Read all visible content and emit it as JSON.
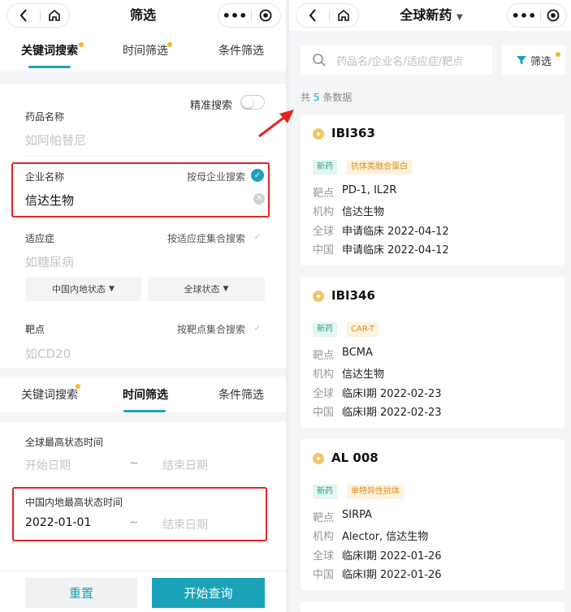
{
  "left": {
    "navbar": {
      "title": "筛选",
      "back_icon": "chevron-left-icon",
      "home_icon": "home-icon",
      "more_icon": "more-dots-icon",
      "record_icon": "target-icon"
    },
    "top_tabs": [
      {
        "label": "关键词搜索",
        "active": true,
        "dot": true
      },
      {
        "label": "时间筛选",
        "active": false,
        "dot": true
      },
      {
        "label": "条件筛选",
        "active": false,
        "dot": false
      }
    ],
    "keyword": {
      "exact_search_label": "精准搜索",
      "drug_name": {
        "label": "药品名称",
        "placeholder": "如阿帕替尼"
      },
      "company": {
        "label": "企业名称",
        "option": "按母企业搜索",
        "option_checked": true,
        "value": "信达生物"
      },
      "indication": {
        "label": "适应症",
        "option": "按适应症集合搜索",
        "option_checked": false,
        "placeholder": "如糖尿病"
      },
      "status_dropdowns": [
        "中国内地状态",
        "全球状态"
      ],
      "target": {
        "label": "靶点",
        "option": "按靶点集合搜索",
        "option_checked": false,
        "placeholder": "如CD20"
      }
    },
    "mid_tabs": [
      {
        "label": "关键词搜索",
        "active": false,
        "dot": true
      },
      {
        "label": "时间筛选",
        "active": true,
        "dot": false
      },
      {
        "label": "条件筛选",
        "active": false,
        "dot": false
      }
    ],
    "time": {
      "global": {
        "label": "全球最高状态时间",
        "start_placeholder": "开始日期",
        "sep": "~",
        "end_placeholder": "结束日期"
      },
      "china": {
        "label": "中国内地最高状态时间",
        "start_value": "2022-01-01",
        "sep": "~",
        "end_placeholder": "结束日期"
      }
    },
    "buttons": {
      "reset": "重置",
      "query": "开始查询"
    }
  },
  "right": {
    "navbar": {
      "title": "全球新药",
      "caret": "▼"
    },
    "search": {
      "placeholder": "药品名/企业名/适应症/靶点"
    },
    "filter_label": "筛选",
    "count": {
      "prefix": "共",
      "number": "5",
      "suffix": "条数据"
    },
    "keys": {
      "target": "靶点",
      "org": "机构",
      "global": "全球",
      "china": "中国"
    },
    "cards": [
      {
        "title": "IBI363",
        "tags": [
          "新药",
          "抗体类融合蛋白"
        ],
        "target": "PD-1, IL2R",
        "org": "信达生物",
        "global": "申请临床 2022-04-12",
        "china": "申请临床 2022-04-12"
      },
      {
        "title": "IBI346",
        "tags": [
          "新药",
          "CAR-T"
        ],
        "target": "BCMA",
        "org": "信达生物",
        "global": "临床I期 2022-02-23",
        "china": "临床I期 2022-02-23"
      },
      {
        "title": "AL 008",
        "tags": [
          "新药",
          "单特异性抗体"
        ],
        "target": "SIRPA",
        "org": "Alector, 信达生物",
        "global": "临床I期 2022-01-26",
        "china": "临床I期 2022-01-26"
      }
    ]
  },
  "colors": {
    "accent": "#1aa3b8",
    "highlight_box": "#e32424",
    "badge_dot": "#f2b632",
    "tag_green": "#27a18a",
    "tag_orange": "#d9911b"
  }
}
